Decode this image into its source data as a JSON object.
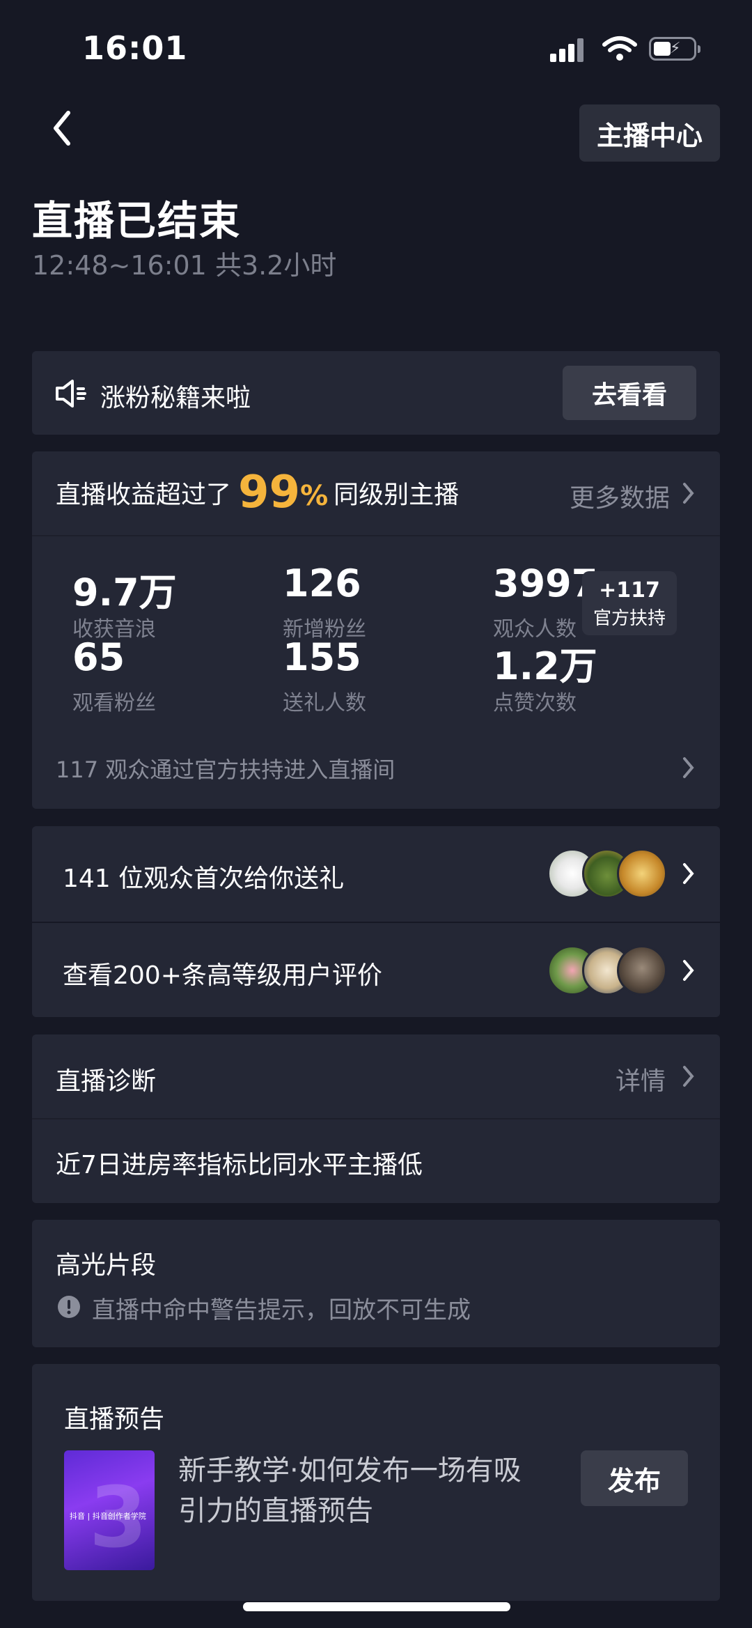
{
  "status_bar": {
    "time": "16:01"
  },
  "header": {
    "host_center_label": "主播中心"
  },
  "summary": {
    "title": "直播已结束",
    "time_range": "12:48~16:01 共3.2小时"
  },
  "tip_card": {
    "text": "涨粉秘籍来啦",
    "button": "去看看"
  },
  "stats_card": {
    "headline_prefix": "直播收益超过了",
    "headline_percent": "99",
    "headline_percent_sign": "%",
    "headline_suffix": "同级别主播",
    "more_data": "更多数据",
    "stats": [
      {
        "value": "9.7万",
        "label": "收获音浪"
      },
      {
        "value": "126",
        "label": "新增粉丝"
      },
      {
        "value": "3997",
        "label": "观众人数"
      },
      {
        "value": "65",
        "label": "观看粉丝"
      },
      {
        "value": "155",
        "label": "送礼人数"
      },
      {
        "value": "1.2万",
        "label": "点赞次数"
      }
    ],
    "badge_count": "+117",
    "badge_label": "官方扶持",
    "footer": "117 观众通过官方扶持进入直播间"
  },
  "gift_row": {
    "text": "141 位观众首次给你送礼"
  },
  "review_row": {
    "text": "查看200+条高等级用户评价"
  },
  "diagnosis": {
    "title": "直播诊断",
    "detail": "详情",
    "content": "近7日进房率指标比同水平主播低"
  },
  "highlights": {
    "title": "高光片段",
    "warning": "直播中命中警告提示，回放不可生成"
  },
  "preview": {
    "title": "直播预告",
    "desc_line1": "新手教学·如何发布一场有吸",
    "desc_line2": "引力的直播预告",
    "thumb_label": "抖音 | 抖音创作者学院",
    "publish": "发布"
  },
  "colors": {
    "accent_orange": "#f5b43c",
    "background": "#161824",
    "card": "#242735"
  }
}
